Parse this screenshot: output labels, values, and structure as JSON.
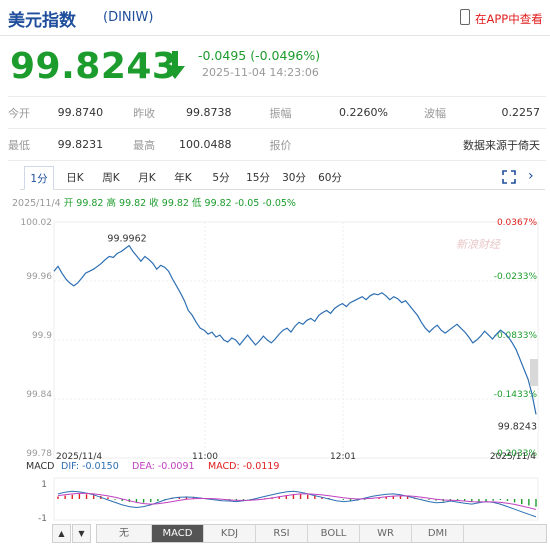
{
  "header": {
    "title": "美元指数",
    "code": "(DINIW)",
    "app_link": "在APP中查看"
  },
  "quote": {
    "price": "99.8243",
    "change": "-0.0495 (-0.0496%)",
    "time": "2025-11-04 14:23:06"
  },
  "stats": [
    [
      {
        "label": "今开",
        "value": "99.8740"
      },
      {
        "label": "昨收",
        "value": "99.8738"
      },
      {
        "label": "振幅",
        "value": "0.2260%"
      },
      {
        "label": "波幅",
        "value": "0.2257"
      }
    ],
    [
      {
        "label": "最低",
        "value": "99.8231"
      },
      {
        "label": "最高",
        "value": "100.0488"
      },
      {
        "label": "报价",
        "value": ""
      },
      {
        "label": "",
        "value": "数据来源于倚天"
      }
    ]
  ],
  "tabs": [
    "1分",
    "日K",
    "周K",
    "月K",
    "年K",
    "5分",
    "15分",
    "30分",
    "60分"
  ],
  "active_tab": 0,
  "info_line": {
    "date": "2025/11/4",
    "open": "开 99.82",
    "high": "高 99.82",
    "close": "收 99.82",
    "low": "低 99.82",
    "change": "-0.05 -0.05%"
  },
  "watermark": "新浪财经",
  "chart_data": {
    "type": "line",
    "x_labels": [
      "2025/11/4",
      "11:00",
      "12:01",
      "2025/11/4"
    ],
    "y_ticks": [
      "100.02",
      "99.96",
      "99.9",
      "99.84",
      "99.78"
    ],
    "y_right_ticks": [
      "0.0367%",
      "-0.0233%",
      "-0.0833%",
      "-0.1433%",
      "-0.2033%"
    ],
    "ylim": [
      99.78,
      100.02
    ],
    "high_label": "99.9962",
    "last_label": "99.8243",
    "series": [
      {
        "values": [
          99.97,
          99.975,
          99.968,
          99.962,
          99.958,
          99.955,
          99.958,
          99.963,
          99.968,
          99.97,
          99.972,
          99.975,
          99.978,
          99.982,
          99.985,
          99.984,
          99.988,
          99.99,
          99.993,
          99.996,
          99.99,
          99.985,
          99.98,
          99.985,
          99.982,
          99.978,
          99.972,
          99.976,
          99.974,
          99.97,
          99.962,
          99.955,
          99.948,
          99.94,
          99.93,
          99.925,
          99.918,
          99.912,
          99.91,
          99.906,
          99.908,
          99.903,
          99.905,
          99.9,
          99.898,
          99.902,
          99.9,
          99.895,
          99.9,
          99.905,
          99.9,
          99.895,
          99.899,
          99.904,
          99.9,
          99.897,
          99.901,
          99.906,
          99.91,
          99.912,
          99.908,
          99.914,
          99.918,
          99.916,
          99.92,
          99.922,
          99.919,
          99.925,
          99.928,
          99.93,
          99.927,
          99.932,
          99.935,
          99.937,
          99.934,
          99.938,
          99.94,
          99.942,
          99.944,
          99.941,
          99.945,
          99.947,
          99.946,
          99.948,
          99.945,
          99.941,
          99.944,
          99.942,
          99.938,
          99.94,
          99.935,
          99.93,
          99.925,
          99.918,
          99.912,
          99.908,
          99.912,
          99.915,
          99.91,
          99.907,
          99.91,
          99.913,
          99.916,
          99.912,
          99.908,
          99.903,
          99.897,
          99.9,
          99.904,
          99.909,
          99.905,
          99.901,
          99.906,
          99.91,
          99.907,
          99.903,
          99.897,
          99.89,
          99.88,
          99.87,
          99.86,
          99.845,
          99.8243
        ]
      }
    ]
  },
  "macd": {
    "label": "MACD",
    "dif": "DIF: -0.0150",
    "dea": "DEA: -0.0091",
    "macd": "MACD: -0.0119",
    "y_ticks": [
      "1",
      "-1"
    ],
    "bars": [
      0.15,
      0.2,
      0.25,
      0.3,
      0.28,
      0.22,
      0.18,
      0.1,
      -0.05,
      -0.12,
      -0.18,
      -0.2,
      -0.22,
      -0.18,
      -0.12,
      -0.05,
      0.05,
      0.1,
      0.15,
      0.12,
      0.08,
      0.05,
      0.02,
      -0.02,
      -0.05,
      -0.08,
      -0.1,
      -0.06,
      -0.02,
      0.05,
      0.1,
      0.16,
      0.22,
      0.28,
      0.3,
      0.25,
      0.2,
      0.12,
      0.06,
      0.0,
      -0.06,
      -0.12,
      -0.1,
      -0.05,
      0.02,
      0.08,
      0.12,
      0.18,
      0.2,
      0.15,
      0.08,
      0.02,
      -0.05,
      -0.1,
      -0.15,
      -0.12,
      -0.08,
      -0.12,
      -0.18,
      -0.2,
      -0.15,
      -0.1,
      -0.06,
      -0.12,
      -0.2,
      -0.3,
      -0.38,
      -0.45
    ],
    "dif_values": [
      0.3,
      0.4,
      0.45,
      0.42,
      0.35,
      0.25,
      0.1,
      -0.05,
      -0.2,
      -0.35,
      -0.45,
      -0.5,
      -0.45,
      -0.35,
      -0.2,
      -0.05,
      0.05,
      0.1,
      0.12,
      0.1,
      0.05,
      0.0,
      -0.05,
      -0.1,
      -0.12,
      -0.15,
      -0.1,
      -0.05,
      0.05,
      0.15,
      0.25,
      0.35,
      0.42,
      0.45,
      0.4,
      0.3,
      0.2,
      0.1,
      0.0,
      -0.1,
      -0.15,
      -0.12,
      -0.05,
      0.05,
      0.15,
      0.22,
      0.28,
      0.3,
      0.25,
      0.15,
      0.05,
      -0.05,
      -0.15,
      -0.22,
      -0.2,
      -0.12,
      -0.18,
      -0.25,
      -0.3,
      -0.22,
      -0.15,
      -0.2,
      -0.3,
      -0.45,
      -0.6,
      -0.75,
      -0.9,
      -1.05
    ],
    "dea_values": [
      0.2,
      0.25,
      0.3,
      0.33,
      0.33,
      0.3,
      0.25,
      0.18,
      0.1,
      0.0,
      -0.1,
      -0.2,
      -0.27,
      -0.3,
      -0.28,
      -0.22,
      -0.15,
      -0.08,
      -0.02,
      0.02,
      0.03,
      0.03,
      0.01,
      -0.02,
      -0.05,
      -0.08,
      -0.08,
      -0.07,
      -0.04,
      0.0,
      0.06,
      0.13,
      0.2,
      0.26,
      0.3,
      0.3,
      0.28,
      0.24,
      0.19,
      0.13,
      0.07,
      0.03,
      0.0,
      0.01,
      0.04,
      0.08,
      0.13,
      0.17,
      0.19,
      0.18,
      0.15,
      0.1,
      0.04,
      -0.02,
      -0.06,
      -0.07,
      -0.09,
      -0.12,
      -0.16,
      -0.17,
      -0.17,
      -0.17,
      -0.2,
      -0.25,
      -0.32,
      -0.41,
      -0.51,
      -0.62
    ]
  },
  "indicators": [
    "无",
    "MACD",
    "KDJ",
    "RSI",
    "BOLL",
    "WR",
    "DMI"
  ],
  "active_indicator": 1,
  "colors": {
    "up": "#e02020",
    "down": "#1c9c2c",
    "line": "#2d6fb3",
    "blue": "#1f4e9c",
    "dea": "#c040c0"
  }
}
